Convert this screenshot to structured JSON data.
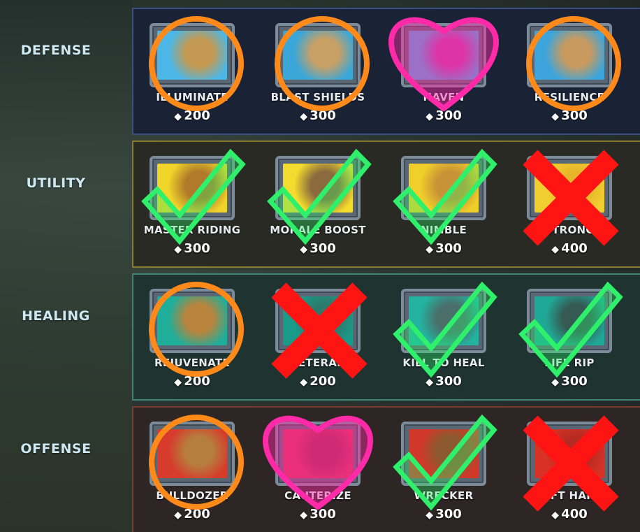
{
  "categories": [
    {
      "label": "DEFENSE",
      "cards": [
        {
          "name": "ILLUMINATE",
          "cost": "200",
          "mark": "circle",
          "art": [
            "#4cb7e6",
            "#c49a52"
          ]
        },
        {
          "name": "BLAST SHIELDS",
          "cost": "300",
          "mark": "circle",
          "art": [
            "#3aa7d8",
            "#c8a066"
          ]
        },
        {
          "name": "HAVEN",
          "cost": "300",
          "mark": "heart",
          "art": [
            "#4aa9de",
            "#c23ea8"
          ]
        },
        {
          "name": "RESILIENCE",
          "cost": "300",
          "mark": "circle",
          "art": [
            "#3da5db",
            "#c89a60"
          ]
        }
      ]
    },
    {
      "label": "UTILITY",
      "cards": [
        {
          "name": "MASTER RIDING",
          "cost": "300",
          "mark": "check",
          "art": [
            "#f1d42a",
            "#b07a2a"
          ]
        },
        {
          "name": "MORALE BOOST",
          "cost": "300",
          "mark": "check",
          "art": [
            "#f4dc2e",
            "#8a6a3e"
          ]
        },
        {
          "name": "NIMBLE",
          "cost": "300",
          "mark": "check",
          "art": [
            "#f0cf2a",
            "#c89236"
          ]
        },
        {
          "name": "STRONG",
          "cost": "400",
          "mark": "cross",
          "art": [
            "#f2cf30",
            "#e7b52a"
          ]
        }
      ]
    },
    {
      "label": "HEALING",
      "cards": [
        {
          "name": "REJUVENATE",
          "cost": "200",
          "mark": "circle",
          "art": [
            "#1fae9a",
            "#b8843e"
          ]
        },
        {
          "name": "VETERAN",
          "cost": "200",
          "mark": "cross",
          "art": [
            "#1a9a88",
            "#2d7a6c"
          ]
        },
        {
          "name": "KILL TO HEAL",
          "cost": "300",
          "mark": "check",
          "art": [
            "#23b3a0",
            "#4a6f6a"
          ]
        },
        {
          "name": "LIFE RIP",
          "cost": "300",
          "mark": "check",
          "art": [
            "#20a896",
            "#355a54"
          ]
        }
      ]
    },
    {
      "label": "OFFENSE",
      "cards": [
        {
          "name": "BULLDOZER",
          "cost": "200",
          "mark": "circle",
          "art": [
            "#d63b2c",
            "#b67e3e"
          ]
        },
        {
          "name": "CAUTERIZE",
          "cost": "300",
          "mark": "heart",
          "art": [
            "#d93656",
            "#a82a4a"
          ]
        },
        {
          "name": "WRECKER",
          "cost": "300",
          "mark": "check",
          "art": [
            "#d2382a",
            "#8c5a2e"
          ]
        },
        {
          "name": "SWIFT HANDS",
          "cost": "400",
          "mark": "cross",
          "art": [
            "#d83226",
            "#b52a22"
          ]
        }
      ]
    }
  ],
  "currency_icon": "crystal-gem-icon",
  "mark_colors": {
    "circle": "#ff8a1a",
    "heart": "#ff2aa8",
    "check": "#2ef06a",
    "cross": "#ff1414"
  }
}
